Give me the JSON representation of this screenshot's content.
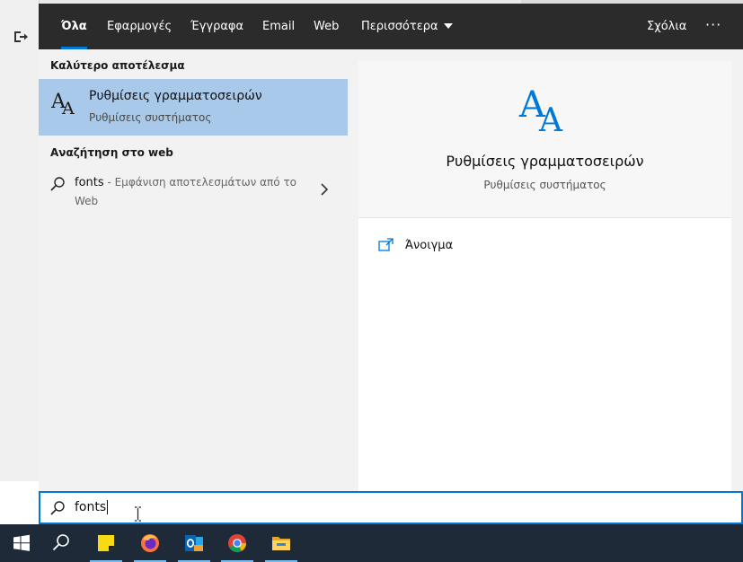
{
  "tabs": [
    {
      "label": "Όλα",
      "active": true
    },
    {
      "label": "Εφαρμογές"
    },
    {
      "label": "Έγγραφα"
    },
    {
      "label": "Email"
    },
    {
      "label": "Web"
    },
    {
      "label": "Περισσότερα"
    }
  ],
  "topbar": {
    "feedback_label": "Σχόλια",
    "more_options": "···"
  },
  "best_match": {
    "section_label": "Καλύτερο αποτέλεσμα",
    "title": "Ρυθμίσεις γραμματοσειρών",
    "subtitle": "Ρυθμίσεις συστήματος",
    "icon": "font-aa-icon"
  },
  "web_search": {
    "section_label": "Αναζήτηση στο web",
    "query": "fonts",
    "suffix_line1": " - Εμφάνιση αποτελεσμάτων από το",
    "suffix_line2": "Web",
    "icon": "search-icon"
  },
  "preview": {
    "title": "Ρυθμίσεις γραμματοσειρών",
    "subtitle": "Ρυθμίσεις συστήματος",
    "open_label": "Άνοιγμα"
  },
  "search": {
    "value": "fonts"
  },
  "taskbar_items": [
    "windows-start-icon",
    "search-icon",
    "sticky-notes-icon",
    "firefox-icon",
    "outlook-icon",
    "chrome-icon",
    "file-explorer-icon"
  ],
  "colors": {
    "accent": "#0078d7",
    "selected": "#a9c9ea",
    "topbar": "#2b2b2b",
    "taskbar": "#1f2a38"
  }
}
